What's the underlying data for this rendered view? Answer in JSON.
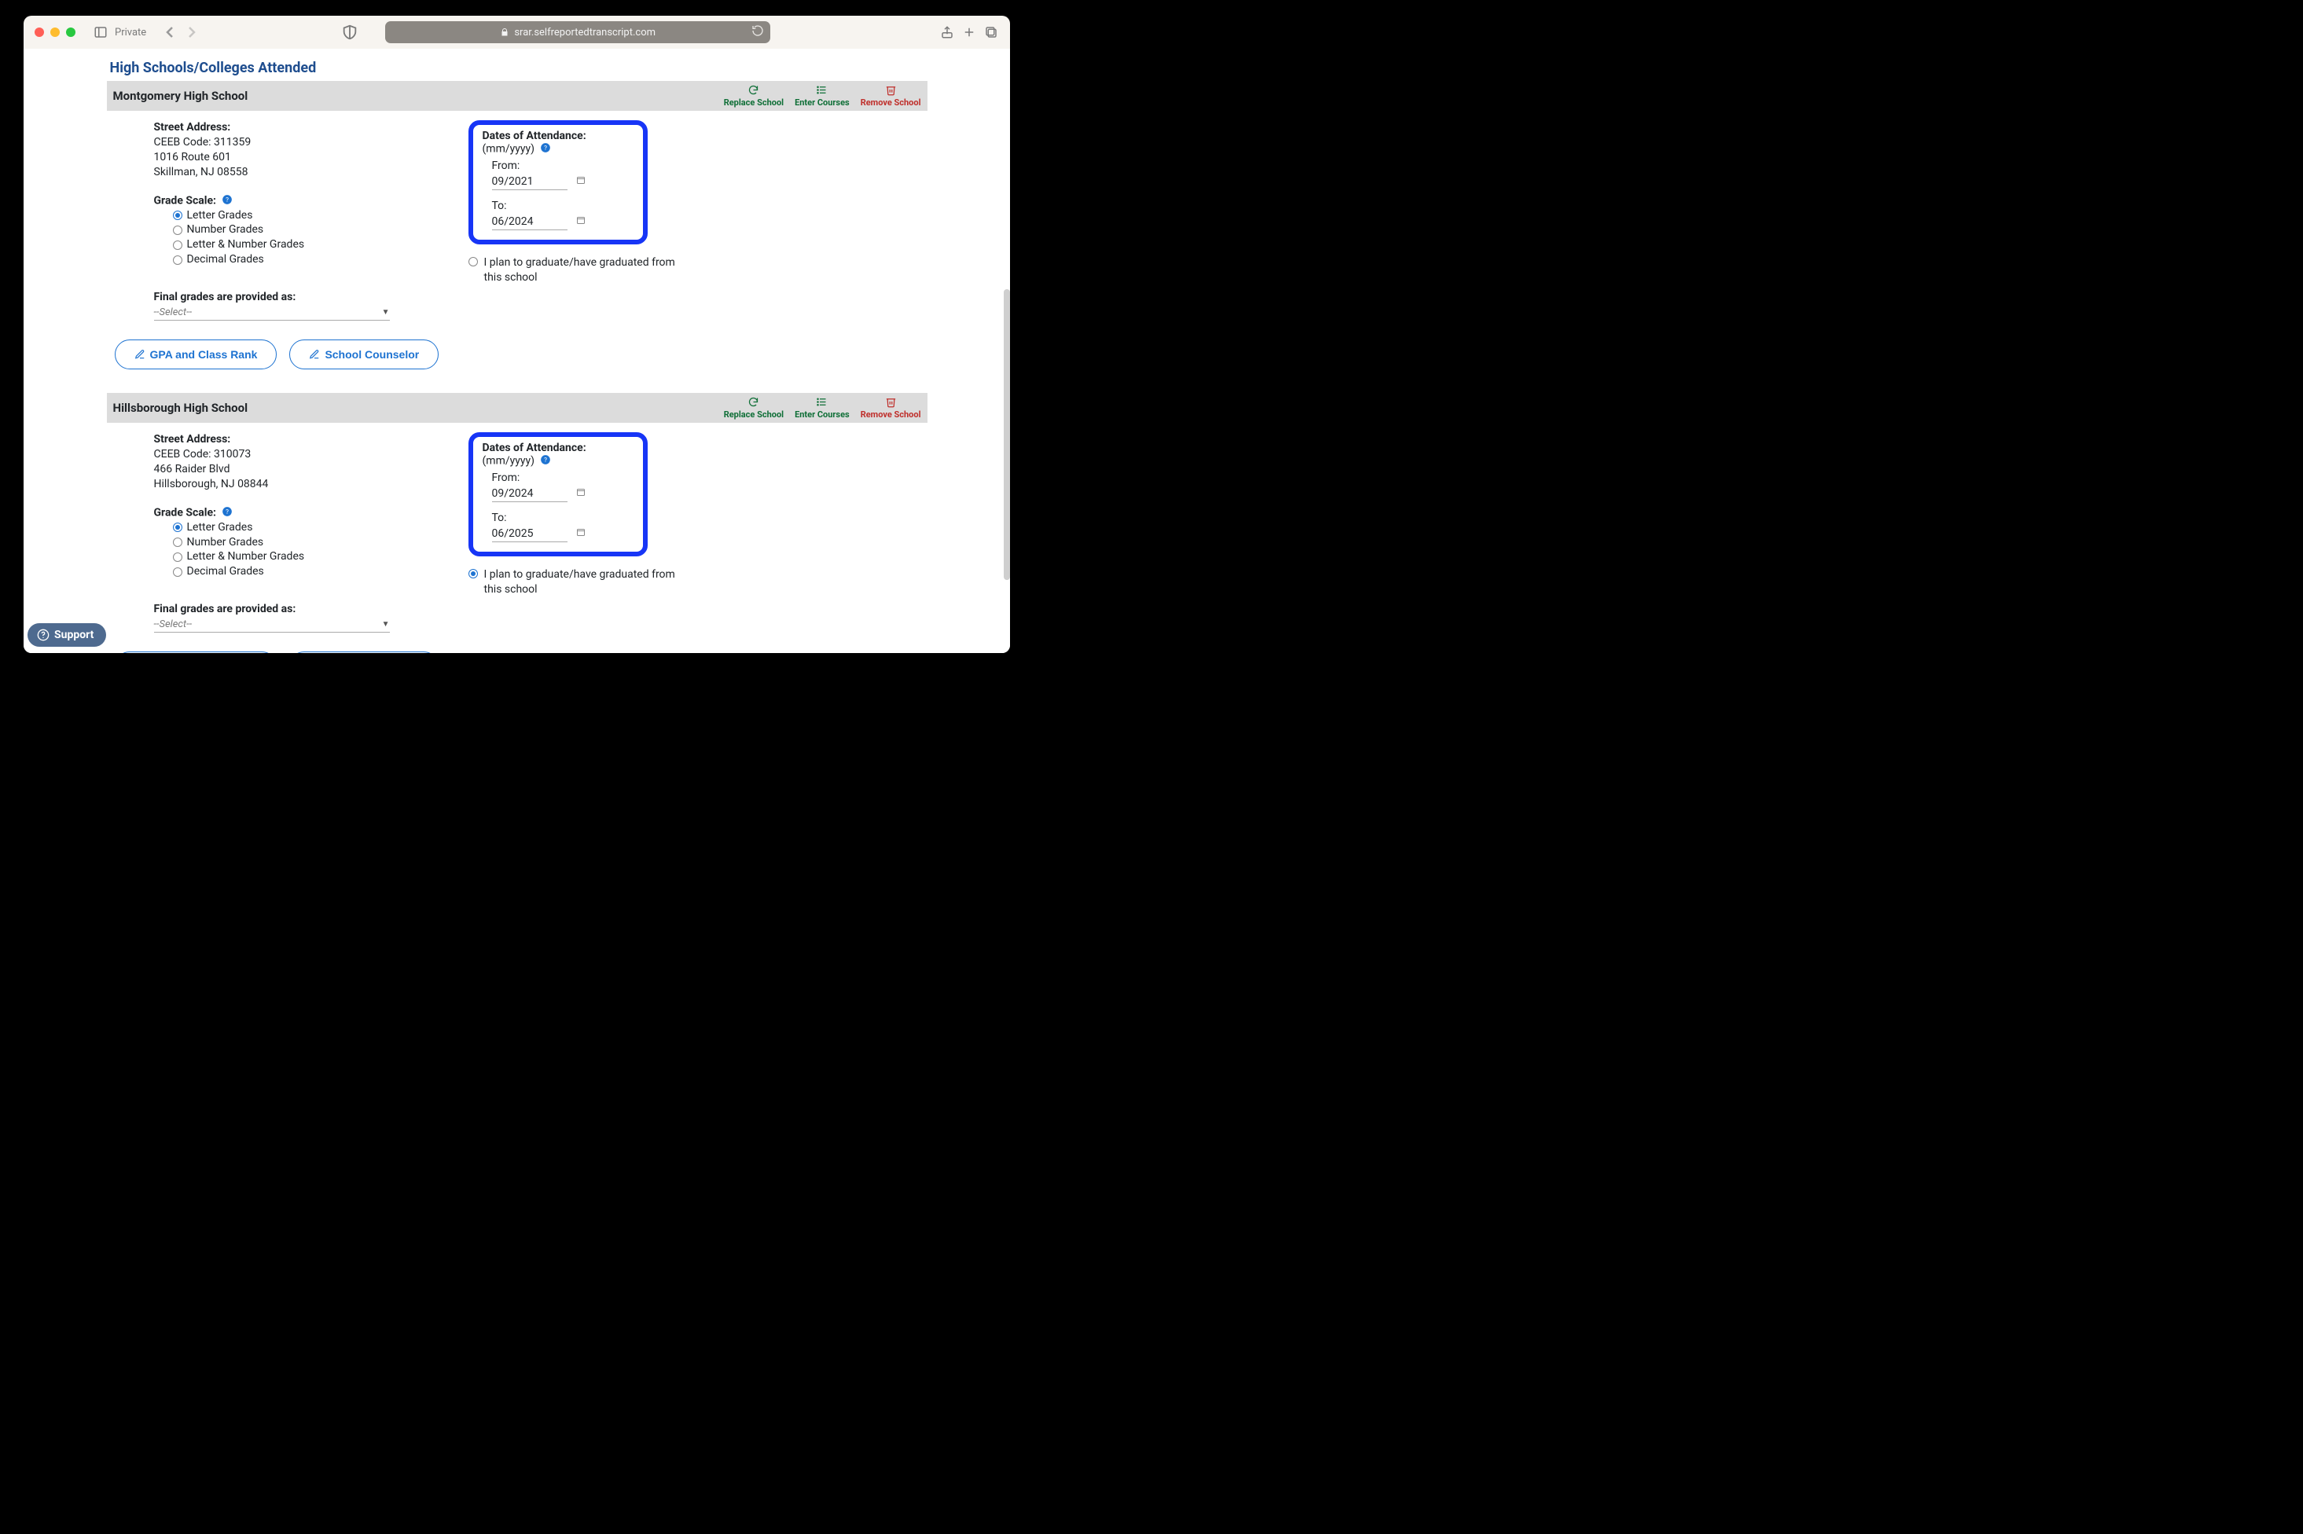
{
  "browser": {
    "private_label": "Private",
    "url_text": "srar.selfreportedtranscript.com"
  },
  "page": {
    "section_title": "High Schools/Colleges Attended",
    "final_grades_label": "Final grades are provided as:",
    "select_placeholder": "--Select--",
    "gpa_button": "GPA and Class Rank",
    "counselor_button": "School Counselor",
    "dates_title": "Dates of Attendance:",
    "dates_format": "(mm/yyyy)",
    "from_label": "From:",
    "to_label": "To:",
    "grad_text": "I plan to graduate/have graduated from this school",
    "street_label": "Street Address:",
    "grade_scale_label": "Grade Scale:",
    "grade_scale_options": [
      "Letter Grades",
      "Number Grades",
      "Letter & Number Grades",
      "Decimal Grades"
    ],
    "actions": {
      "replace": "Replace School",
      "enter": "Enter Courses",
      "remove": "Remove School"
    }
  },
  "schools": [
    {
      "name": "Montgomery High School",
      "ceeb": "CEEB Code: 311359",
      "street": "1016 Route 601",
      "citystate": "Skillman, NJ 08558",
      "from": "09/2021",
      "to": "06/2024",
      "grad_checked": false
    },
    {
      "name": "Hillsborough High School",
      "ceeb": "CEEB Code: 310073",
      "street": "466 Raider Blvd",
      "citystate": "Hillsborough, NJ 08844",
      "from": "09/2024",
      "to": "06/2025",
      "grad_checked": true
    }
  ],
  "support": {
    "label": "Support"
  }
}
